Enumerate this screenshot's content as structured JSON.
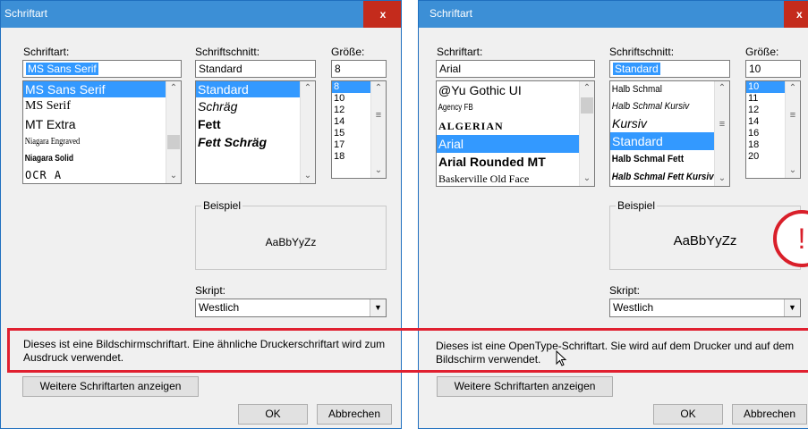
{
  "left": {
    "title": "Schriftart",
    "close": "x",
    "font_label": "Schriftart:",
    "style_label": "Schriftschnitt:",
    "size_label": "Größe:",
    "font_value": "MS Sans Serif",
    "style_value": "Standard",
    "size_value": "8",
    "fonts": [
      "MS Sans Serif",
      "MS Serif",
      "MT Extra",
      "Niagara Engraved",
      "Niagara Solid",
      "OCR A"
    ],
    "styles": [
      "Standard",
      "Schräg",
      "Fett",
      "Fett Schräg"
    ],
    "sizes": [
      "8",
      "10",
      "12",
      "14",
      "15",
      "17",
      "18"
    ],
    "sample_label": "Beispiel",
    "sample_text": "AaBbYyZz",
    "script_label": "Skript:",
    "script_value": "Westlich",
    "description": "Dieses ist eine Bildschirmschriftart. Eine ähnliche Druckerschriftart wird zum Ausdruck verwendet.",
    "more_fonts": "Weitere Schriftarten anzeigen",
    "ok": "OK",
    "cancel": "Abbrechen"
  },
  "right": {
    "title": "Schriftart",
    "close": "x",
    "font_label": "Schriftart:",
    "style_label": "Schriftschnitt:",
    "size_label": "Größe:",
    "font_value": "Arial",
    "style_value": "Standard",
    "size_value": "10",
    "fonts": [
      "@Yu Gothic UI",
      "Agency FB",
      "ALGERIAN",
      "Arial",
      "Arial Rounded MT",
      "Baskerville Old Face"
    ],
    "styles": [
      "Halb Schmal",
      "Halb Schmal Kursiv",
      "Kursiv",
      "Standard",
      "Halb Schmal Fett",
      "Halb Schmal Fett Kursiv"
    ],
    "sizes": [
      "10",
      "11",
      "12",
      "14",
      "16",
      "18",
      "20"
    ],
    "sample_label": "Beispiel",
    "sample_text": "AaBbYyZz",
    "script_label": "Skript:",
    "script_value": "Westlich",
    "description": "Dieses ist eine OpenType-Schriftart. Sie wird auf dem Drucker und auf dem Bildschirm verwendet.",
    "more_fonts": "Weitere Schriftarten anzeigen",
    "ok": "OK",
    "cancel": "Abbrechen",
    "warning_mark": "!"
  },
  "colors": {
    "selection": "#3399ff",
    "titlebar": "#3c8fd6",
    "close": "#c42b1c",
    "highlight": "#e02030"
  }
}
